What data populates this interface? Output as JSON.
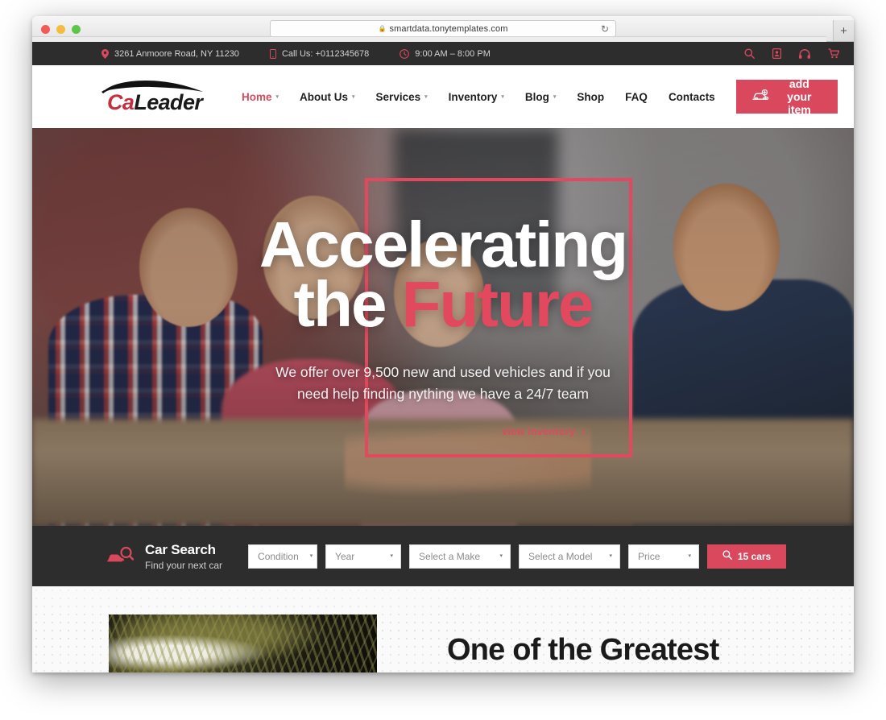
{
  "browser": {
    "url": "smartdata.tonytemplates.com",
    "lock_icon": "lock-icon",
    "reload_icon": "reload-icon",
    "newtab_label": "+"
  },
  "topbar": {
    "address": "3261 Anmoore Road, NY 11230",
    "phone": "Call Us: +0112345678",
    "hours": "9:00 AM – 8:00 PM",
    "icons": [
      "search-icon",
      "user-card-icon",
      "headphones-icon",
      "cart-icon"
    ]
  },
  "header": {
    "logo_part1": "Ca",
    "logo_part2": "Leader",
    "nav": [
      {
        "label": "Home",
        "active": true,
        "caret": "▾"
      },
      {
        "label": "About Us",
        "active": false,
        "caret": "▾"
      },
      {
        "label": "Services",
        "active": false,
        "caret": "▾"
      },
      {
        "label": "Inventory",
        "active": false,
        "caret": "▾"
      },
      {
        "label": "Blog",
        "active": false,
        "caret": "▾"
      },
      {
        "label": "Shop",
        "active": false,
        "caret": ""
      },
      {
        "label": "FAQ",
        "active": false,
        "caret": ""
      },
      {
        "label": "Contacts",
        "active": false,
        "caret": ""
      }
    ],
    "cta_label": "add your item"
  },
  "hero": {
    "title_line1": "Accelerating",
    "title_line2_white": "the ",
    "title_line2_accent": "Future",
    "subtitle": "We offer over 9,500 new and used vehicles and if you need help finding nything we have a 24/7 team",
    "link_label": "view inventory",
    "link_caret": "›"
  },
  "car_search": {
    "title": "Car Search",
    "subtitle": "Find your next car",
    "selects": [
      {
        "label": "Condition",
        "caret": "▾"
      },
      {
        "label": "Year",
        "caret": "▾"
      },
      {
        "label": "Select a Make",
        "caret": "▾"
      },
      {
        "label": "Select a Model",
        "caret": "▾"
      },
      {
        "label": "Price",
        "caret": "▾"
      }
    ],
    "submit_label": "15 cars"
  },
  "below": {
    "heading": "One of the Greatest"
  },
  "colors": {
    "accent": "#d9485d",
    "accent_bright": "#e2485e",
    "dark": "#2d2d2d",
    "logo_red": "#c32f3f"
  }
}
